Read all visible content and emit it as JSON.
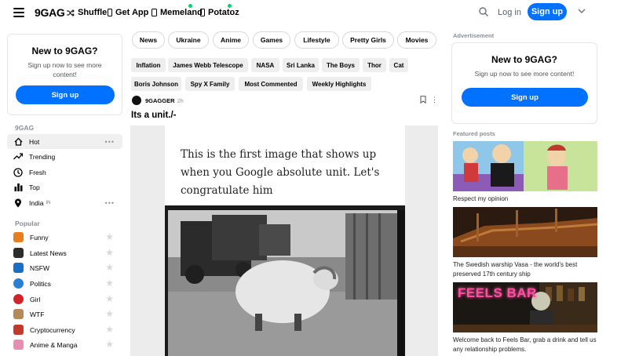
{
  "header": {
    "logo": "9GAG",
    "nav": [
      {
        "label": "Shuffle",
        "icon": "shuffle-icon"
      },
      {
        "label": "Get App",
        "icon": "phone-icon"
      },
      {
        "label": "Memeland",
        "icon": "memeland-icon"
      },
      {
        "label": "Potatoz",
        "icon": "potatoz-icon"
      }
    ],
    "login": "Log in",
    "signup": "Sign up"
  },
  "promo": {
    "title": "New to 9GAG?",
    "text": "Sign up now to see more content!",
    "button": "Sign up"
  },
  "left": {
    "section1": "9GAG",
    "main_nav": [
      {
        "label": "Hot",
        "icon": "flame-icon"
      },
      {
        "label": "Trending",
        "icon": "trending-icon"
      },
      {
        "label": "Fresh",
        "icon": "clock-icon"
      },
      {
        "label": "Top",
        "icon": "bar-chart-icon"
      },
      {
        "label": "India",
        "tag": "IN",
        "icon": "location-icon"
      }
    ],
    "section2": "Popular",
    "popular": [
      {
        "label": "Funny",
        "color": "#e67e22"
      },
      {
        "label": "Latest News",
        "color": "#2c2c2c"
      },
      {
        "label": "NSFW",
        "color": "#1a6fc4"
      },
      {
        "label": "Politics",
        "color": "#2a7fd4"
      },
      {
        "label": "Girl",
        "color": "#d0242b"
      },
      {
        "label": "WTF",
        "color": "#b58a5a"
      },
      {
        "label": "Cryptocurrency",
        "color": "#c0392b"
      },
      {
        "label": "Anime & Manga",
        "color": "#e78fb3"
      }
    ]
  },
  "main": {
    "pills": [
      "News",
      "Ukraine",
      "Anime",
      "Games",
      "Lifestyle",
      "Pretty Girls",
      "Movies"
    ],
    "chips_row1": [
      "Inflation",
      "James Webb Telescope",
      "NASA",
      "Sri Lanka",
      "The Boys",
      "Thor",
      "Cat"
    ],
    "chips_row2": [
      "Boris Johnson",
      "Spy X Family",
      "Most Commented",
      "Weekly Highlights"
    ],
    "post": {
      "author": "9GAGGER",
      "time": "2h",
      "title": "Its a unit./-",
      "image_caption": "This is the first image that shows up when you Google absolute unit. Let's congratulate him"
    }
  },
  "right": {
    "ad_label": "Advertisement",
    "featured_title": "Featured posts",
    "featured": [
      {
        "caption": "Respect my opinion"
      },
      {
        "caption": "The Swedish warship Vasa - the world's best preserved 17th century ship"
      },
      {
        "caption": "Welcome back to Feels Bar, grab a drink and tell us any relationship problems.",
        "thumb_text": "FEELS BAR"
      }
    ]
  },
  "colors": {
    "accent": "#0072ff",
    "online_dot": "#0ece6e"
  }
}
